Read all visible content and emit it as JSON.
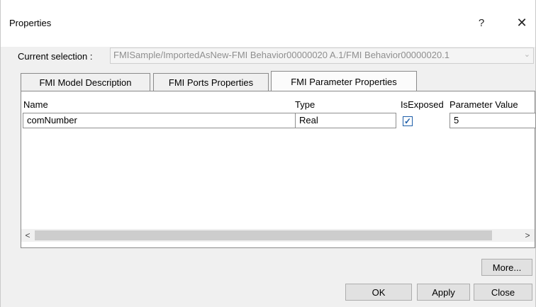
{
  "window": {
    "title": "Properties",
    "help_label": "?",
    "close_label": "✕"
  },
  "selection": {
    "label": "Current selection :",
    "value": "FMISample/ImportedAsNew-FMI Behavior00000020 A.1/FMI Behavior00000020.1",
    "dropdown_icon": "chevron-down-icon"
  },
  "tabs": [
    {
      "label": "FMI Model Description",
      "active": false
    },
    {
      "label": "FMI Ports Properties",
      "active": false
    },
    {
      "label": "FMI Parameter Properties",
      "active": true
    }
  ],
  "table": {
    "columns": [
      "Name",
      "Type",
      "IsExposed",
      "Parameter Value"
    ],
    "rows": [
      {
        "name": "comNumber",
        "type": "Real",
        "is_exposed": true,
        "value": "5"
      }
    ]
  },
  "scrollbar": {
    "left_arrow": "<",
    "right_arrow": ">"
  },
  "buttons": {
    "more": "More...",
    "ok": "OK",
    "apply": "Apply",
    "close": "Close"
  }
}
